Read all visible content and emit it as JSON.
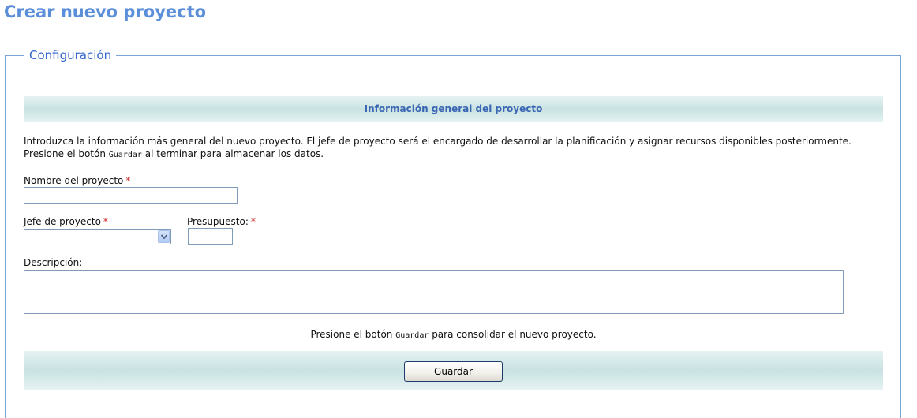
{
  "page": {
    "title": "Crear nuevo proyecto"
  },
  "fieldset": {
    "legend": "Configuración"
  },
  "section": {
    "title": "Información general del proyecto",
    "intro_part1": "Introduzca la información más general del nuevo proyecto. El jefe de proyecto será el encargado de desarrollar la planificación y asignar recursos disponibles posteriormente.",
    "intro_part2": "Presione el botón ",
    "intro_code": "Guardar",
    "intro_part3": " al terminar para almacenar los datos."
  },
  "form": {
    "nombre_label": "Nombre del proyecto",
    "nombre_value": "",
    "jefe_label": "Jefe de proyecto",
    "jefe_selected": "",
    "presupuesto_label": "Presupuesto:",
    "presupuesto_value": "",
    "descripcion_label": "Descripción:",
    "descripcion_value": "",
    "required_mark": "*"
  },
  "footer": {
    "confirm_part1": "Presione el botón ",
    "confirm_code": "Guardar",
    "confirm_part2": " para consolidar el nuevo proyecto.",
    "save_label": "Guardar"
  },
  "icons": {
    "select_arrow": "chevron-down-icon"
  },
  "colors": {
    "title": "#5b8fd9",
    "legend": "#3366cc",
    "section_title": "#3a66b3",
    "required": "#cc2222",
    "band": "#c9e2e2"
  }
}
